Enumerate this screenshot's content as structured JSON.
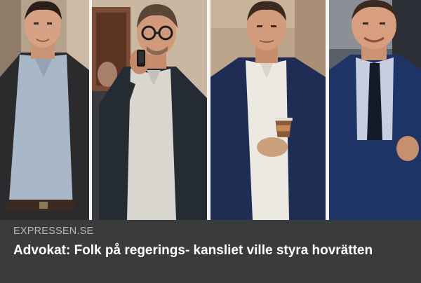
{
  "article": {
    "source": "EXPRESSEN.SE",
    "headline": "Advokat: Folk på regerings- kansliet ville styra hovrätten"
  },
  "icons": [
    "smartphone-icon",
    "coffee-cup-icon"
  ],
  "colors": {
    "caption_background": "#3a3b3d",
    "source_text": "#b4b6b9",
    "headline_text": "#ffffff",
    "divider": "#f6f6f6"
  }
}
